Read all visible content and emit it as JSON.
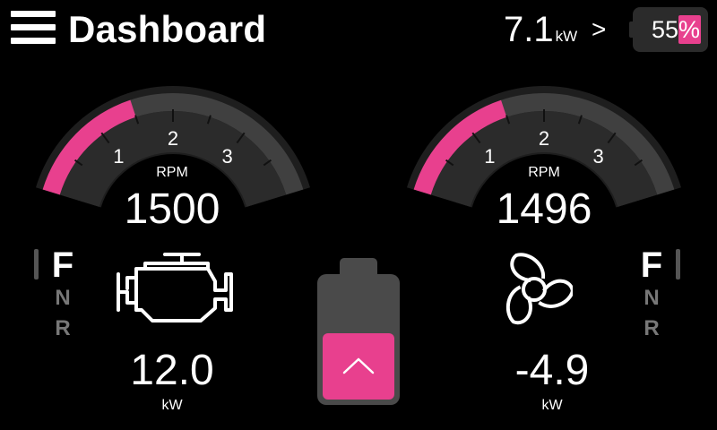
{
  "header": {
    "title": "Dashboard",
    "menu_icon": "hamburger-menu-icon",
    "power": {
      "value": "7.1",
      "unit": "kW"
    },
    "chevron": ">",
    "battery": {
      "percent_text": "55%",
      "level_percent": 55
    }
  },
  "gauges": [
    {
      "id": "left",
      "label": "RPM",
      "value": "1500",
      "fill_rpm": 1500,
      "max_rpm": 4000,
      "ticks": [
        "1",
        "2",
        "3"
      ]
    },
    {
      "id": "right",
      "label": "RPM",
      "value": "1496",
      "fill_rpm": 1496,
      "max_rpm": 4000,
      "ticks": [
        "1",
        "2",
        "3"
      ]
    }
  ],
  "left_gear": {
    "active": "F",
    "others": [
      "N",
      "R"
    ]
  },
  "right_gear": {
    "active": "F",
    "others": [
      "N",
      "R"
    ]
  },
  "engine": {
    "icon": "engine-icon",
    "power_value": "12.0",
    "unit": "kW"
  },
  "propeller": {
    "icon": "propeller-icon",
    "power_value": "-4.9",
    "unit": "kW"
  },
  "center": {
    "battery_icon": "battery-icon",
    "button_icon": "chevron-up-icon"
  },
  "colors": {
    "accent": "#e8408e",
    "gauge_track": "#404040",
    "gauge_face": "#2b2b2b",
    "dim_text": "#777777"
  }
}
